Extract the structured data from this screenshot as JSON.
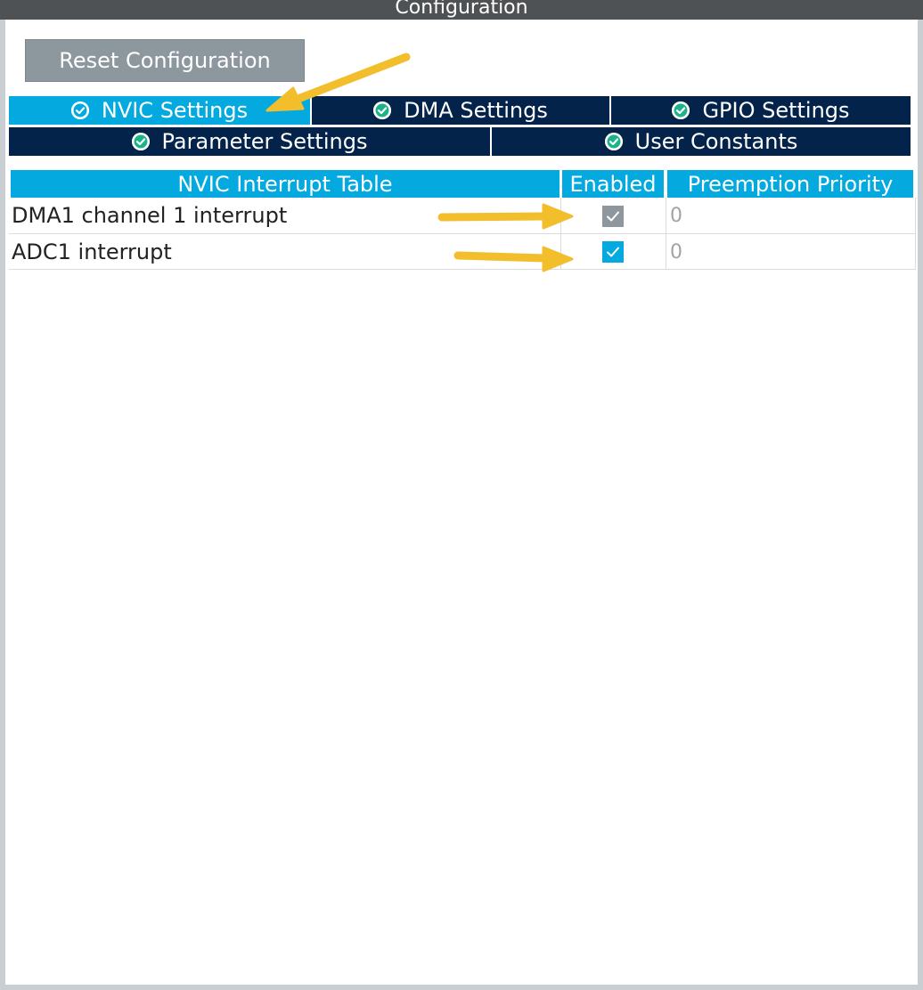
{
  "window": {
    "title": "Configuration"
  },
  "toolbar": {
    "reset_label": "Reset Configuration"
  },
  "tabs": [
    {
      "label": "NVIC Settings",
      "active": true,
      "icon": "check-circle-icon"
    },
    {
      "label": "DMA Settings",
      "active": false,
      "icon": "check-circle-icon"
    },
    {
      "label": "GPIO Settings",
      "active": false,
      "icon": "check-circle-icon"
    },
    {
      "label": "Parameter Settings",
      "active": false,
      "icon": "check-circle-icon"
    },
    {
      "label": "User Constants",
      "active": false,
      "icon": "check-circle-icon"
    }
  ],
  "table": {
    "headers": [
      "NVIC Interrupt Table",
      "Enabled",
      "Preemption Priority"
    ],
    "rows": [
      {
        "name": "DMA1 channel 1 interrupt",
        "enabled": true,
        "editable": false,
        "priority": "0"
      },
      {
        "name": "ADC1 interrupt",
        "enabled": true,
        "editable": true,
        "priority": "0"
      }
    ]
  },
  "colors": {
    "active_tab": "#03a9df",
    "inactive_tab": "#03234b",
    "header": "#03a9df",
    "button": "#8c979e",
    "annotation_arrow": "#f2be2c"
  }
}
